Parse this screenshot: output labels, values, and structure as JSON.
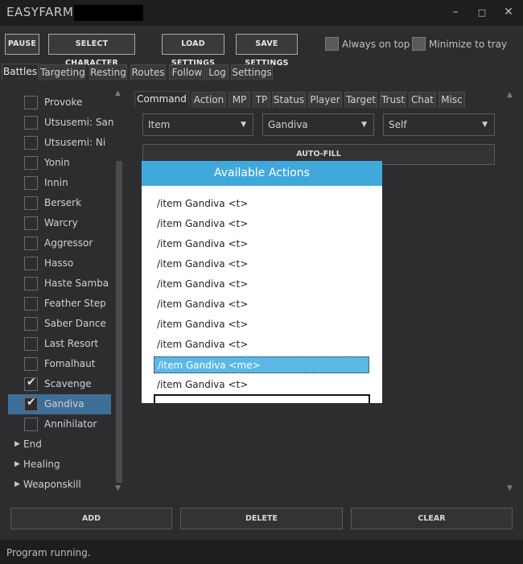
{
  "window": {
    "title": "EASYFARM -"
  },
  "toolbar": {
    "pause": "PAUSE",
    "select_character": "SELECT CHARACTER",
    "load_settings": "LOAD SETTINGS",
    "save_settings": "SAVE SETTINGS",
    "always_on_top": "Always on top",
    "minimize_to_tray": "Minimize to tray"
  },
  "main_tabs": [
    "Battles",
    "Targeting",
    "Resting",
    "Routes",
    "Follow",
    "Log",
    "Settings"
  ],
  "sub_tabs": [
    "Command",
    "Action",
    "MP",
    "TP",
    "Status",
    "Player",
    "Target",
    "Trust",
    "Chat",
    "Misc"
  ],
  "abilities": [
    {
      "label": "Provoke",
      "checked": false
    },
    {
      "label": "Utsusemi: San",
      "checked": false
    },
    {
      "label": "Utsusemi: Ni",
      "checked": false
    },
    {
      "label": "Yonin",
      "checked": false
    },
    {
      "label": "Innin",
      "checked": false
    },
    {
      "label": "Berserk",
      "checked": false
    },
    {
      "label": "Warcry",
      "checked": false
    },
    {
      "label": "Aggressor",
      "checked": false
    },
    {
      "label": "Hasso",
      "checked": false
    },
    {
      "label": "Haste Samba",
      "checked": false
    },
    {
      "label": "Feather Step",
      "checked": false
    },
    {
      "label": "Saber Dance",
      "checked": false
    },
    {
      "label": "Last Resort",
      "checked": false
    },
    {
      "label": "Fomalhaut",
      "checked": false
    },
    {
      "label": "Scavenge",
      "checked": true
    },
    {
      "label": "Gandiva",
      "checked": true,
      "selected": true
    },
    {
      "label": "Annihilator",
      "checked": false
    }
  ],
  "tree_groups": [
    "End",
    "Healing",
    "Weaponskill"
  ],
  "command": {
    "type": "Item",
    "name": "Gandiva",
    "target": "Self",
    "autofill": "AUTO-FILL"
  },
  "modal": {
    "title": "Available Actions",
    "actions": [
      "/item Gandiva <t>",
      "/item Gandiva <t>",
      "/item Gandiva <t>",
      "/item Gandiva <t>",
      "/item Gandiva <t>",
      "/item Gandiva <t>",
      "/item Gandiva <t>",
      "/item Gandiva <t>",
      "/item Gandiva <me>",
      "/item Gandiva <t>"
    ],
    "selected_index": 8
  },
  "bottom": {
    "add": "ADD",
    "delete": "DELETE",
    "clear": "CLEAR"
  },
  "status": "Program running.",
  "colors": {
    "accent": "#41a8dc",
    "selection": "#3e6f98",
    "modal_selection": "#5bb8e6"
  }
}
